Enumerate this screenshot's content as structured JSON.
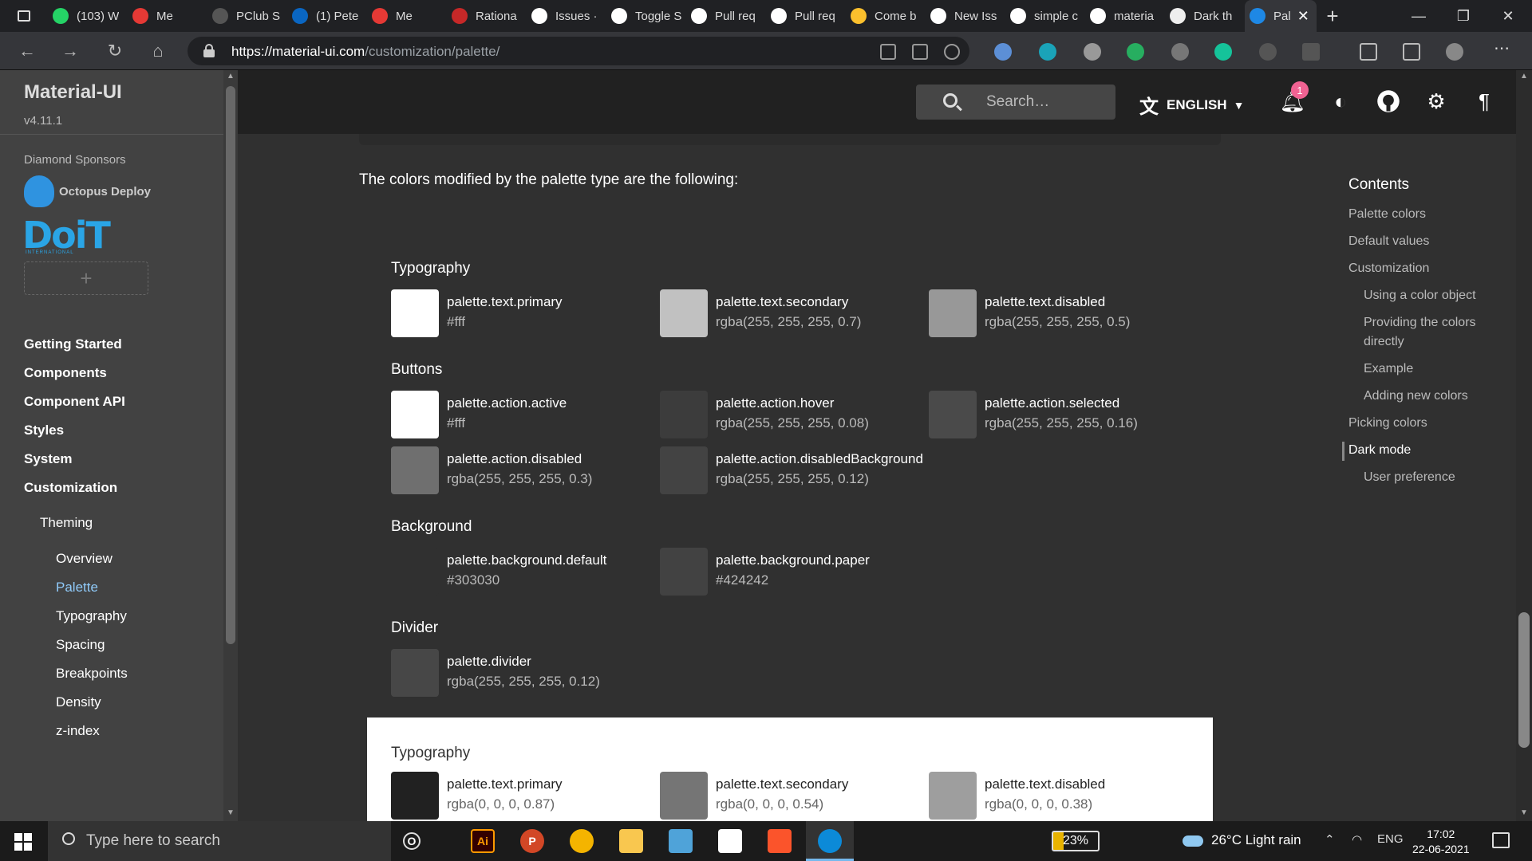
{
  "browser": {
    "tabs": [
      {
        "label": "(103) W",
        "icon": "whatsapp-icon",
        "color": "#25d366"
      },
      {
        "label": "Me",
        "icon": "meet-icon",
        "color": "#e53935"
      },
      {
        "label": "PClub S",
        "icon": "pclub-icon",
        "color": "#555555"
      },
      {
        "label": "(1) Pete",
        "icon": "linkedin-icon",
        "color": "#0a66c2"
      },
      {
        "label": "Me",
        "icon": "meet-icon",
        "color": "#e53935"
      },
      {
        "label": "Rationa",
        "icon": "bookmark-icon",
        "color": "#c62828"
      },
      {
        "label": "Issues ·",
        "icon": "github-icon",
        "color": "#ffffff"
      },
      {
        "label": "Toggle S",
        "icon": "github-icon",
        "color": "#ffffff"
      },
      {
        "label": "Pull req",
        "icon": "github-icon",
        "color": "#ffffff"
      },
      {
        "label": "Pull req",
        "icon": "github-icon",
        "color": "#ffffff"
      },
      {
        "label": "Come b",
        "icon": "warning-icon",
        "color": "#fbc02d"
      },
      {
        "label": "New Iss",
        "icon": "github-icon",
        "color": "#ffffff"
      },
      {
        "label": "simple c",
        "icon": "google-icon",
        "color": "#ffffff"
      },
      {
        "label": "materia",
        "icon": "google-icon",
        "color": "#ffffff"
      },
      {
        "label": "Dark th",
        "icon": "page-icon",
        "color": "#eeeeee"
      },
      {
        "label": "Pal",
        "icon": "mui-icon",
        "color": "#1e88e5",
        "active": true
      }
    ],
    "url_host": "https://material-ui.com",
    "url_path": "/customization/palette/"
  },
  "sidebar": {
    "brand": "Material-UI",
    "version": "v4.11.1",
    "sponsor_heading": "Diamond Sponsors",
    "sponsor_octopus": "Octopus Deploy",
    "sponsor_doit": "DoiT",
    "sponsor_doit_sub": "INTERNATIONAL",
    "sponsor_add": "+",
    "nav": [
      {
        "label": "Getting Started"
      },
      {
        "label": "Components"
      },
      {
        "label": "Component API"
      },
      {
        "label": "Styles"
      },
      {
        "label": "System"
      },
      {
        "label": "Customization"
      }
    ],
    "theming": "Theming",
    "subnav": [
      {
        "label": "Overview"
      },
      {
        "label": "Palette",
        "active": true
      },
      {
        "label": "Typography"
      },
      {
        "label": "Spacing"
      },
      {
        "label": "Breakpoints"
      },
      {
        "label": "Density"
      },
      {
        "label": "z-index"
      }
    ]
  },
  "appbar": {
    "search_placeholder": "Search…",
    "language": "ENGLISH",
    "notification_count": "1"
  },
  "main": {
    "intro": "The colors modified by the palette type are the following:",
    "dark_groups": [
      {
        "title": "Typography",
        "items": [
          {
            "name": "palette.text.primary",
            "value": "#fff",
            "swatch": "#ffffff"
          },
          {
            "name": "palette.text.secondary",
            "value": "rgba(255, 255, 255, 0.7)",
            "swatch": "#c1c1c1"
          },
          {
            "name": "palette.text.disabled",
            "value": "rgba(255, 255, 255, 0.5)",
            "swatch": "#989898"
          }
        ]
      },
      {
        "title": "Buttons",
        "items": [
          {
            "name": "palette.action.active",
            "value": "#fff",
            "swatch": "#ffffff"
          },
          {
            "name": "palette.action.hover",
            "value": "rgba(255, 255, 255, 0.08)",
            "swatch": "#3c3c3c"
          },
          {
            "name": "palette.action.selected",
            "value": "rgba(255, 255, 255, 0.16)",
            "swatch": "#4a4a4a"
          },
          {
            "name": "palette.action.disabled",
            "value": "rgba(255, 255, 255, 0.3)",
            "swatch": "#6f6f6f"
          },
          {
            "name": "palette.action.disabledBackground",
            "value": "rgba(255, 255, 255, 0.12)",
            "swatch": "#434343"
          }
        ]
      },
      {
        "title": "Background",
        "items": [
          {
            "name": "palette.background.default",
            "value": "#303030",
            "swatch": "#303030"
          },
          {
            "name": "palette.background.paper",
            "value": "#424242",
            "swatch": "#424242"
          }
        ]
      },
      {
        "title": "Divider",
        "items": [
          {
            "name": "palette.divider",
            "value": "rgba(255, 255, 255, 0.12)",
            "swatch": "#474747"
          }
        ]
      }
    ],
    "light_group": {
      "title": "Typography",
      "items": [
        {
          "name": "palette.text.primary",
          "value": "rgba(0, 0, 0, 0.87)",
          "swatch": "#212121"
        },
        {
          "name": "palette.text.secondary",
          "value": "rgba(0, 0, 0, 0.54)",
          "swatch": "#757575"
        },
        {
          "name": "palette.text.disabled",
          "value": "rgba(0, 0, 0, 0.38)",
          "swatch": "#9e9e9e"
        }
      ]
    }
  },
  "toc": {
    "title": "Contents",
    "items": [
      {
        "label": "Palette colors",
        "level": 1
      },
      {
        "label": "Default values",
        "level": 1
      },
      {
        "label": "Customization",
        "level": 1
      },
      {
        "label": "Using a color object",
        "level": 2
      },
      {
        "label": "Providing the colors",
        "level": 2
      },
      {
        "label": "directly",
        "level": 2
      },
      {
        "label": "Example",
        "level": 2
      },
      {
        "label": "Adding new colors",
        "level": 2
      },
      {
        "label": "Picking colors",
        "level": 1
      },
      {
        "label": "Dark mode",
        "level": 1,
        "active": true
      },
      {
        "label": "User preference",
        "level": 2
      }
    ]
  },
  "taskbar": {
    "search_placeholder": "Type here to search",
    "battery": "23%",
    "weather": "26°C  Light rain",
    "lang": "ENG",
    "time": "17:02",
    "date": "22-06-2021",
    "apps": [
      {
        "icon": "task-view-icon",
        "text": "O"
      },
      {
        "icon": "illustrator-icon",
        "text": "Ai"
      },
      {
        "icon": "powerpoint-icon",
        "text": "P"
      },
      {
        "icon": "chrome-canary-icon",
        "text": ""
      },
      {
        "icon": "file-explorer-icon",
        "text": ""
      },
      {
        "icon": "notepad-icon",
        "text": ""
      },
      {
        "icon": "slack-icon",
        "text": ""
      },
      {
        "icon": "brave-icon",
        "text": ""
      },
      {
        "icon": "edge-icon",
        "text": ""
      }
    ]
  }
}
